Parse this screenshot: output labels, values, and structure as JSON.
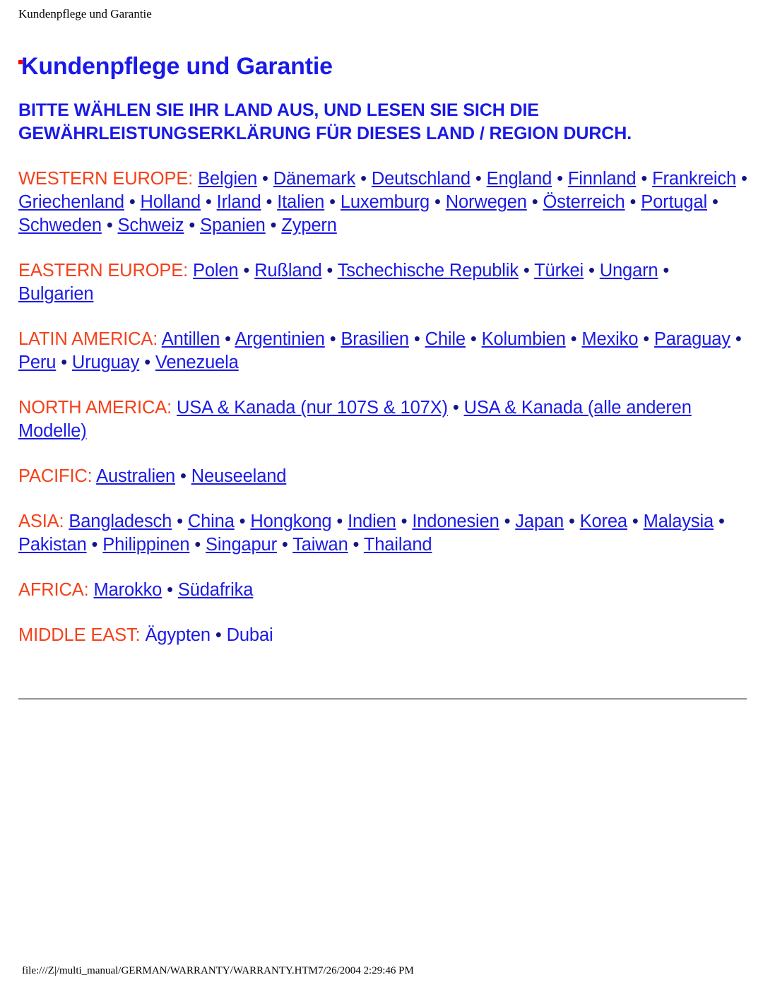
{
  "header": {
    "running_title": "Kundenpflege und Garantie"
  },
  "title": "Kundenpflege und Garantie",
  "instruction": "BITTE WÄHLEN SIE IHR LAND AUS, UND LESEN SIE SICH DIE GEWÄHRLEISTUNGSERKLÄRUNG FÜR DIESES LAND / REGION DURCH.",
  "colors": {
    "title_blue": "#1a1ae6",
    "link_blue": "#1a1ae6",
    "region_label_orange": "#f4411a",
    "separator": "#151585",
    "page_background": "#ffffff",
    "anchor_dot_red": "#ff0000",
    "divider_gray": "#9a9a9a"
  },
  "separator_glyph": "•",
  "regions": [
    {
      "label": "WESTERN EUROPE:",
      "underlined": true,
      "links": [
        "Belgien",
        "Dänemark",
        "Deutschland",
        "England",
        "Finnland",
        "Frankreich",
        "Griechenland",
        "Holland",
        "Irland",
        "Italien",
        "Luxemburg",
        "Norwegen",
        "Österreich",
        "Portugal",
        "Schweden",
        "Schweiz",
        "Spanien",
        "Zypern"
      ]
    },
    {
      "label": "EASTERN EUROPE:",
      "underlined": true,
      "links": [
        "Polen",
        "Rußland",
        "Tschechische Republik",
        "Türkei",
        "Ungarn",
        "Bulgarien"
      ]
    },
    {
      "label": "LATIN AMERICA:",
      "underlined": true,
      "links": [
        "Antillen",
        "Argentinien",
        "Brasilien",
        "Chile",
        "Kolumbien",
        "Mexiko",
        "Paraguay",
        "Peru",
        "Uruguay",
        "Venezuela"
      ]
    },
    {
      "label": "NORTH AMERICA:",
      "underlined": true,
      "links": [
        "USA & Kanada (nur 107S & 107X)",
        "USA & Kanada (alle anderen Modelle)"
      ]
    },
    {
      "label": "PACIFIC:",
      "underlined": true,
      "links": [
        "Australien",
        "Neuseeland"
      ]
    },
    {
      "label": "ASIA:",
      "underlined": true,
      "links": [
        "Bangladesch",
        "China",
        "Hongkong",
        "Indien",
        "Indonesien",
        "Japan",
        "Korea",
        "Malaysia",
        "Pakistan",
        "Philippinen",
        "Singapur",
        "Taiwan",
        "Thailand"
      ]
    },
    {
      "label": "AFRICA:",
      "underlined": true,
      "links": [
        "Marokko",
        "Südafrika"
      ]
    },
    {
      "label": "MIDDLE EAST:",
      "underlined": false,
      "links": [
        "Ägypten",
        "Dubai"
      ]
    }
  ],
  "footer": {
    "path_and_timestamp": "file:///Z|/multi_manual/GERMAN/WARRANTY/WARRANTY.HTM7/26/2004 2:29:46 PM"
  }
}
